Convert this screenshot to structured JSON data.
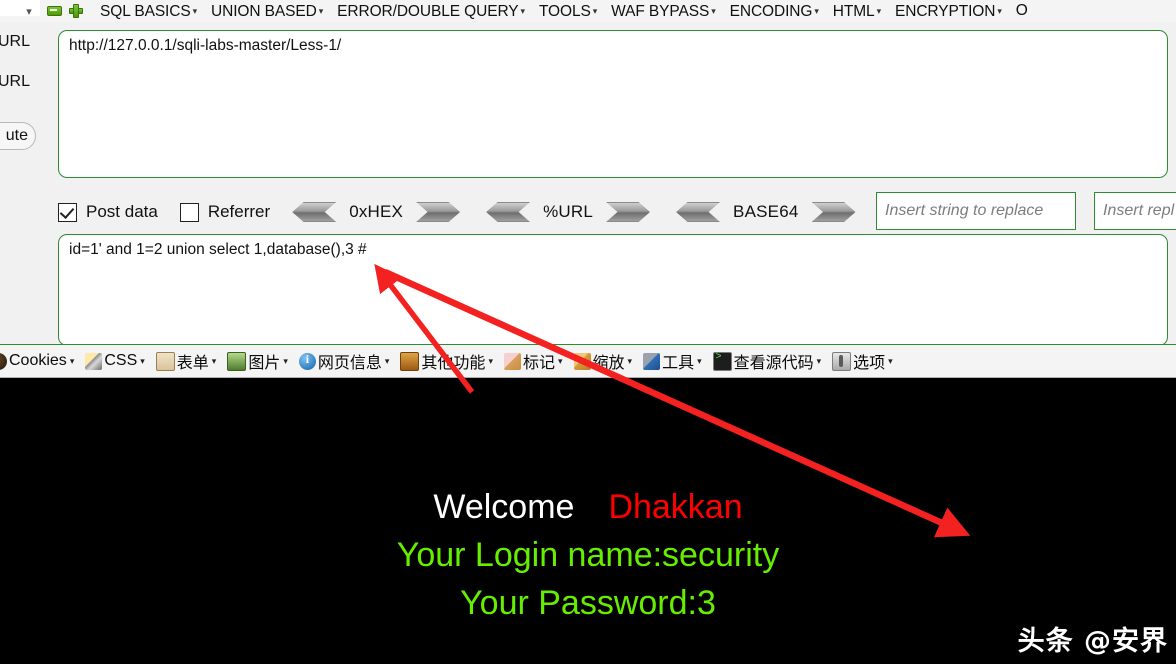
{
  "topbar": {
    "chevron_icon": "chevron-down-icon",
    "minus_icon": "minus-badge-icon",
    "plus_icon": "plus-badge-icon",
    "caret": "▾",
    "menus": [
      {
        "label": "SQL BASICS"
      },
      {
        "label": "UNION BASED"
      },
      {
        "label": "ERROR/DOUBLE QUERY"
      },
      {
        "label": "TOOLS"
      },
      {
        "label": "WAF BYPASS"
      },
      {
        "label": "ENCODING"
      },
      {
        "label": "HTML"
      },
      {
        "label": "ENCRYPTION"
      },
      {
        "label": "O"
      }
    ]
  },
  "leftrail": {
    "label_1": "URL",
    "label_2": "URL",
    "button_label": "ute"
  },
  "url_field": {
    "value": "http://127.0.0.1/sqli-labs-master/Less-1/"
  },
  "options": {
    "post_data": {
      "label": "Post data",
      "checked": true
    },
    "referrer": {
      "label": "Referrer",
      "checked": false
    },
    "encoders": [
      {
        "label": "0xHEX"
      },
      {
        "label": "%URL"
      },
      {
        "label": "BASE64"
      }
    ],
    "replace_input_1": {
      "value": "",
      "placeholder": "Insert string to replace"
    },
    "replace_input_2": {
      "value": "",
      "placeholder": "Insert repl"
    }
  },
  "data_field": {
    "value": "id=1' and 1=2 union select 1,database(),3 #"
  },
  "devbar": {
    "caret": "▾",
    "items": [
      {
        "label": "Cookies",
        "icon": "cookie-icon"
      },
      {
        "label": "CSS",
        "icon": "css-pencil-icon"
      },
      {
        "label": "表单",
        "icon": "clipboard-form-icon"
      },
      {
        "label": "图片",
        "icon": "image-icon"
      },
      {
        "label": "网页信息",
        "icon": "info-icon"
      },
      {
        "label": "其他功能",
        "icon": "other-tools-icon"
      },
      {
        "label": "标记",
        "icon": "marker-pencil-icon"
      },
      {
        "label": "缩放",
        "icon": "ruler-zoom-icon"
      },
      {
        "label": "工具",
        "icon": "wrench-tools-icon"
      },
      {
        "label": "查看源代码",
        "icon": "view-source-icon"
      },
      {
        "label": "选项",
        "icon": "options-icon"
      }
    ]
  },
  "result": {
    "welcome": "Welcome",
    "username_banner": "Dhakkan",
    "login_name_line": "Your Login name:security",
    "password_line": "Your Password:3",
    "watermark": "头条 @安界"
  },
  "colors": {
    "accent_green_border": "#2e8b33",
    "panel_bg": "#f1f1f1",
    "result_bg": "#000000",
    "result_green": "#66ee00",
    "result_red": "#ff0000",
    "annotation_red": "#f42121"
  }
}
